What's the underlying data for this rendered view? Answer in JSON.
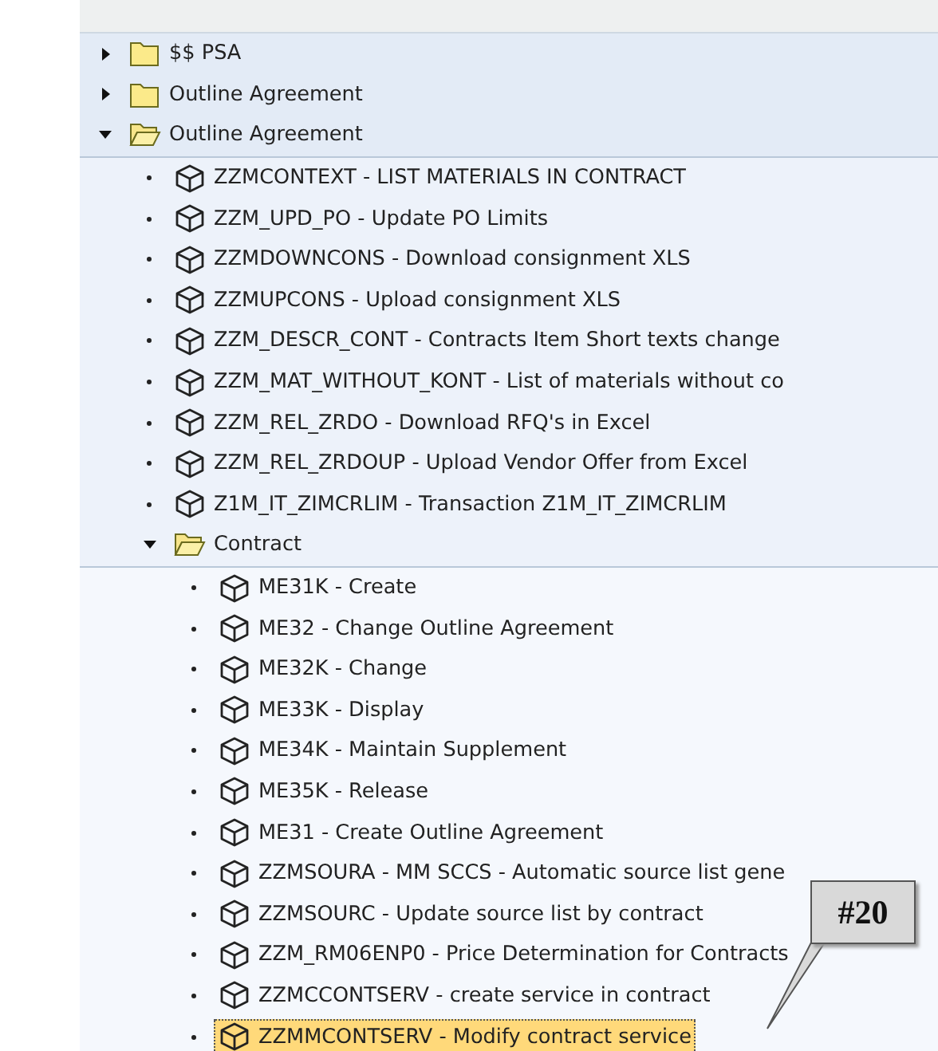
{
  "tree": [
    {
      "label": "$$ PSA",
      "kind": "folder",
      "expanded": false,
      "selected": false
    },
    {
      "label": "Outline Agreement",
      "kind": "folder",
      "expanded": false,
      "selected": false
    },
    {
      "label": "Outline Agreement",
      "kind": "folder",
      "expanded": true,
      "selected": false,
      "children": [
        {
          "label": "ZZMCONTEXT - LIST MATERIALS IN CONTRACT",
          "kind": "transaction",
          "selected": false
        },
        {
          "label": "ZZM_UPD_PO - Update PO Limits",
          "kind": "transaction",
          "selected": false
        },
        {
          "label": "ZZMDOWNCONS - Download consignment XLS",
          "kind": "transaction",
          "selected": false
        },
        {
          "label": "ZZMUPCONS - Upload consignment XLS",
          "kind": "transaction",
          "selected": false
        },
        {
          "label": "ZZM_DESCR_CONT - Contracts Item Short texts change",
          "kind": "transaction",
          "selected": false
        },
        {
          "label": "ZZM_MAT_WITHOUT_KONT - List of materials without co",
          "kind": "transaction",
          "selected": false
        },
        {
          "label": "ZZM_REL_ZRDO - Download RFQ's in Excel",
          "kind": "transaction",
          "selected": false
        },
        {
          "label": "ZZM_REL_ZRDOUP - Upload Vendor Offer from Excel",
          "kind": "transaction",
          "selected": false
        },
        {
          "label": "Z1M_IT_ZIMCRLIM - Transaction Z1M_IT_ZIMCRLIM",
          "kind": "transaction",
          "selected": false
        },
        {
          "label": "Contract",
          "kind": "folder",
          "expanded": true,
          "selected": false,
          "children": [
            {
              "label": "ME31K - Create",
              "kind": "transaction",
              "selected": false
            },
            {
              "label": "ME32 - Change Outline Agreement",
              "kind": "transaction",
              "selected": false
            },
            {
              "label": "ME32K - Change",
              "kind": "transaction",
              "selected": false
            },
            {
              "label": "ME33K - Display",
              "kind": "transaction",
              "selected": false
            },
            {
              "label": "ME34K - Maintain Supplement",
              "kind": "transaction",
              "selected": false
            },
            {
              "label": "ME35K - Release",
              "kind": "transaction",
              "selected": false
            },
            {
              "label": "ME31 - Create Outline Agreement",
              "kind": "transaction",
              "selected": false
            },
            {
              "label": "ZZMSOURA - MM SCCS - Automatic source list gene",
              "kind": "transaction",
              "selected": false
            },
            {
              "label": "ZZMSOURC - Update source list by contract",
              "kind": "transaction",
              "selected": false
            },
            {
              "label": "ZZM_RM06ENP0 - Price Determination for Contracts",
              "kind": "transaction",
              "selected": false
            },
            {
              "label": "ZZMCCONTSERV - create service in contract",
              "kind": "transaction",
              "selected": false
            },
            {
              "label": "ZZMMCONTSERV - Modify contract service",
              "kind": "transaction",
              "selected": true
            }
          ]
        }
      ]
    }
  ],
  "callout": {
    "label": "#20"
  }
}
